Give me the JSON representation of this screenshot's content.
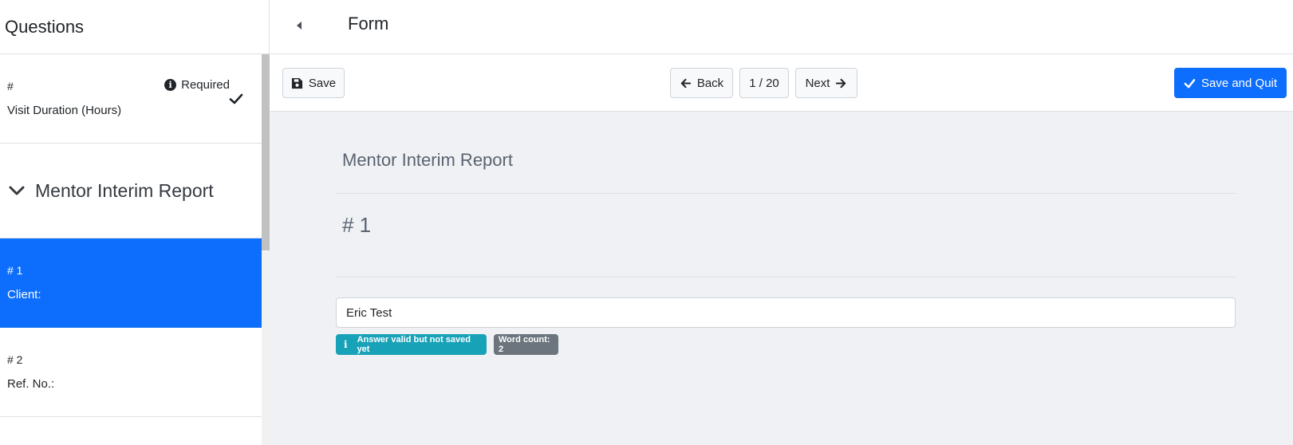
{
  "sidebar": {
    "title": "Questions",
    "prev_item": {
      "number": "#",
      "label": "Visit Duration (Hours)",
      "required_label": "Required"
    },
    "section": {
      "title": "Mentor Interim Report"
    },
    "items": [
      {
        "number": "# 1",
        "label": "Client:"
      },
      {
        "number": "# 2",
        "label": "Ref. No.:"
      }
    ]
  },
  "topbar": {
    "title": "Form"
  },
  "toolbar": {
    "save_label": "Save",
    "back_label": "Back",
    "page_indicator": "1 / 20",
    "next_label": "Next",
    "save_quit_label": "Save and Quit"
  },
  "main": {
    "report_title": "Mentor Interim Report",
    "question_number": "# 1",
    "answer_value": "Eric Test",
    "status_badge": "Answer valid but not saved yet",
    "word_count": "Word count: 2"
  },
  "colors": {
    "primary": "#0d6efd",
    "info": "#17a2b8",
    "secondary": "#6c757d",
    "main_bg": "#f0f1f4"
  },
  "icons": {
    "save": "floppy-disk-icon",
    "back": "arrow-left-icon",
    "next": "arrow-right-icon",
    "save_quit": "check-icon",
    "collapse": "caret-left-icon",
    "section": "chevron-down-icon",
    "info": "info-circle-icon"
  }
}
